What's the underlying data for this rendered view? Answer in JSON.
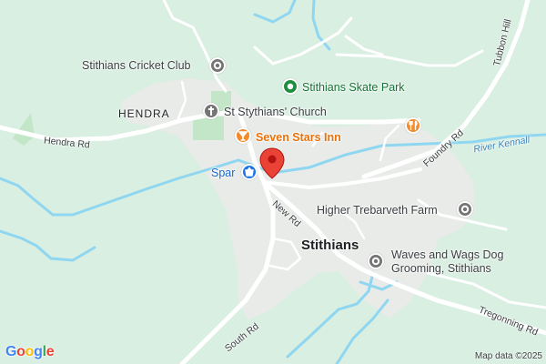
{
  "map": {
    "logo_text": "Google",
    "attribution": "Map data ©2025",
    "colors": {
      "land": "#d9efe2",
      "urban": "#e8ebe8",
      "green": "#c3e6c8",
      "water": "#8fd6f0",
      "road": "#ffffff",
      "pin": "#ea4335",
      "food_icon": "#f28b2c",
      "park_icon": "#1e8e3e",
      "shop_icon": "#1a73e8",
      "poi_icon": "#757575"
    },
    "places": {
      "cricket_club": "Stithians Cricket Club",
      "skate_park": "Stithians Skate Park",
      "church": "St Stythians' Church",
      "pub": "Seven Stars Inn",
      "shop": "Spar",
      "farm": "Higher Trebarveth Farm",
      "groomer_line1": "Waves and Wags Dog",
      "groomer_line2": "Grooming, Stithians"
    },
    "areas": {
      "hamlet": "HENDRA",
      "town": "Stithians"
    },
    "roads": {
      "hendra": "Hendra Rd",
      "new": "New Rd",
      "foundry": "Foundry Rd",
      "south": "South Rd",
      "tubbon": "Tubbon Hill",
      "tregonning": "Tregonning Rd"
    },
    "water": {
      "river": "River Kennall"
    },
    "icons": {
      "selected": "red-location-pin",
      "cricket": "place-icon",
      "skate": "park-icon",
      "church": "church-cross-icon",
      "pub": "cocktail-icon",
      "shop": "shopping-basket-icon",
      "restaurant": "fork-knife-icon",
      "farm": "place-icon",
      "groomer": "place-icon"
    }
  }
}
